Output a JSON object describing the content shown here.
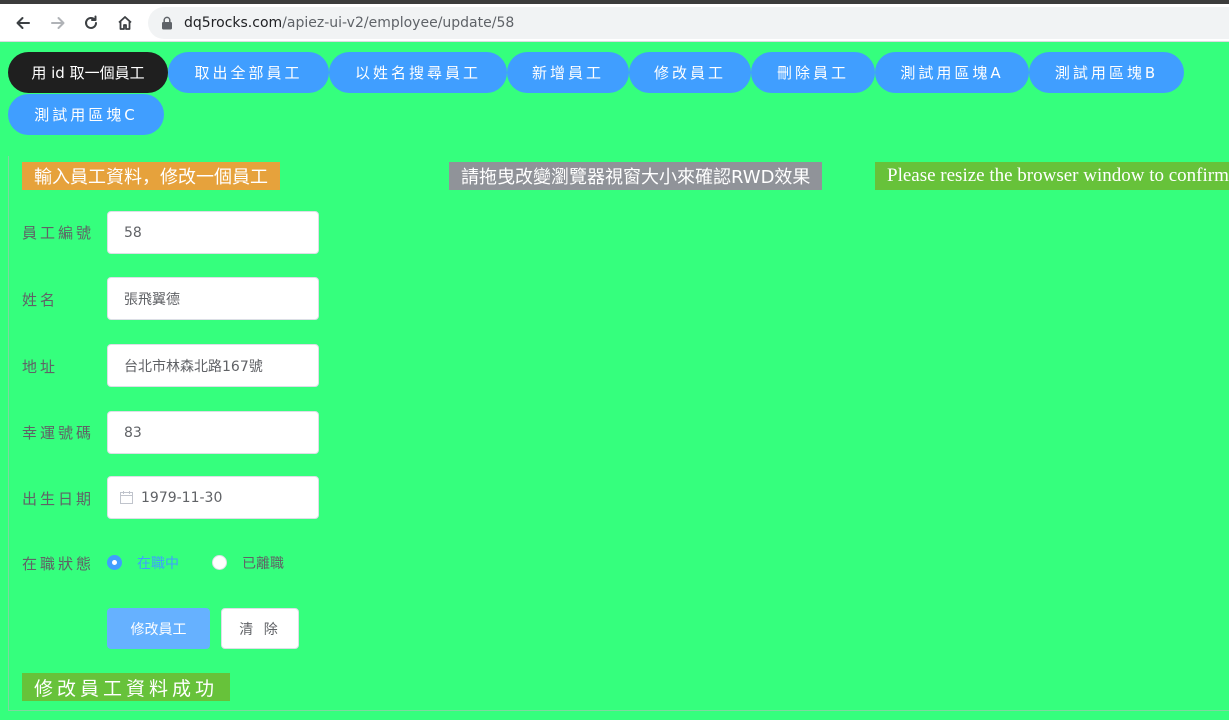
{
  "browser": {
    "url_host": "dq5rocks.com",
    "url_path": "/apiez-ui-v2/employee/update/58"
  },
  "nav": {
    "items": [
      {
        "label": "用 id 取一個員工",
        "active": true
      },
      {
        "label": "取出全部員工"
      },
      {
        "label": "以姓名搜尋員工"
      },
      {
        "label": "新增員工"
      },
      {
        "label": "修改員工"
      },
      {
        "label": "刪除員工"
      },
      {
        "label": "測試用區塊A"
      },
      {
        "label": "測試用區塊B"
      },
      {
        "label": "測試用區塊C"
      }
    ]
  },
  "header": {
    "form_title": "輸入員工資料，修改一個員工",
    "rwd_hint_zh": "請拖曳改變瀏覽器視窗大小來確認RWD效果",
    "rwd_hint_en": "Please resize the browser window to confirm"
  },
  "form": {
    "employee_id": {
      "label": "員工編號",
      "value": "58"
    },
    "name": {
      "label": "姓名",
      "value": "張飛翼德"
    },
    "address": {
      "label": "地址",
      "value": "台北市林森北路167號"
    },
    "lucky_number": {
      "label": "幸運號碼",
      "value": "83"
    },
    "birthday": {
      "label": "出生日期",
      "value": "1979-11-30"
    },
    "status": {
      "label": "在職狀態",
      "options": [
        "在職中",
        "已離職"
      ],
      "selected": "在職中"
    },
    "submit_label": "修改員工",
    "clear_label": "清 除"
  },
  "result": {
    "message": "修改員工資料成功"
  },
  "colors": {
    "background": "#35ff7d",
    "primary": "#409eff",
    "warning": "#e6a23c",
    "info": "#909399",
    "success": "#67c23a"
  }
}
